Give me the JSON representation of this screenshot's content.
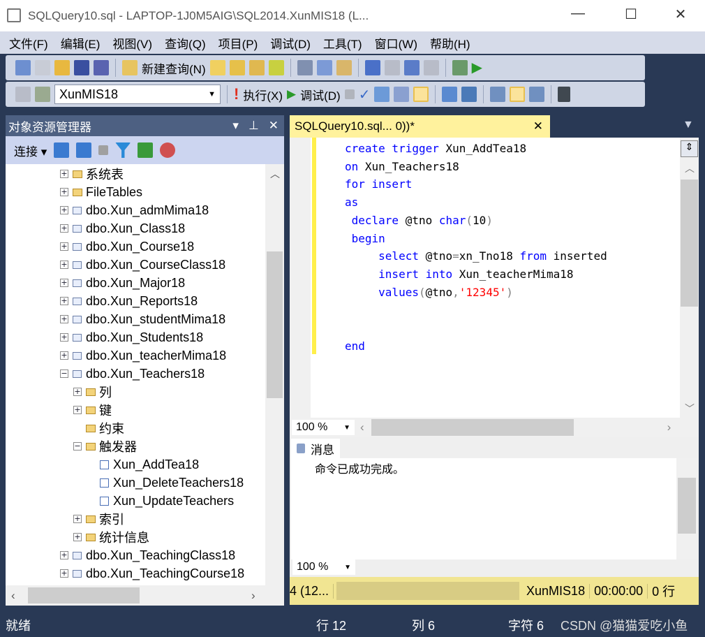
{
  "window": {
    "title": "SQLQuery10.sql - LAPTOP-1J0M5AIG\\SQL2014.XunMIS18 (L...",
    "min": "—",
    "max": "☐",
    "close": "✕"
  },
  "menu": [
    "文件(F)",
    "编辑(E)",
    "视图(V)",
    "查询(Q)",
    "项目(P)",
    "调试(D)",
    "工具(T)",
    "窗口(W)",
    "帮助(H)"
  ],
  "toolbar1": {
    "new_query": "新建查询(N)"
  },
  "toolbar2": {
    "database": "XunMIS18",
    "execute": "执行(X)",
    "debug": "调试(D)"
  },
  "object_explorer": {
    "title": "对象资源管理器",
    "connect": "连接",
    "tree": [
      {
        "label": "系统表",
        "type": "folder",
        "level": 0,
        "expander": "+"
      },
      {
        "label": "FileTables",
        "type": "folder",
        "level": 0,
        "expander": "+"
      },
      {
        "label": "dbo.Xun_admMima18",
        "type": "table",
        "level": 0,
        "expander": "+"
      },
      {
        "label": "dbo.Xun_Class18",
        "type": "table",
        "level": 0,
        "expander": "+"
      },
      {
        "label": "dbo.Xun_Course18",
        "type": "table",
        "level": 0,
        "expander": "+"
      },
      {
        "label": "dbo.Xun_CourseClass18",
        "type": "table",
        "level": 0,
        "expander": "+"
      },
      {
        "label": "dbo.Xun_Major18",
        "type": "table",
        "level": 0,
        "expander": "+"
      },
      {
        "label": "dbo.Xun_Reports18",
        "type": "table",
        "level": 0,
        "expander": "+"
      },
      {
        "label": "dbo.Xun_studentMima18",
        "type": "table",
        "level": 0,
        "expander": "+"
      },
      {
        "label": "dbo.Xun_Students18",
        "type": "table",
        "level": 0,
        "expander": "+"
      },
      {
        "label": "dbo.Xun_teacherMima18",
        "type": "table",
        "level": 0,
        "expander": "+"
      },
      {
        "label": "dbo.Xun_Teachers18",
        "type": "table",
        "level": 0,
        "expander": "−"
      },
      {
        "label": "列",
        "type": "folder",
        "level": 1,
        "expander": "+"
      },
      {
        "label": "键",
        "type": "folder",
        "level": 1,
        "expander": "+"
      },
      {
        "label": "约束",
        "type": "folder",
        "level": 1,
        "expander": ""
      },
      {
        "label": "触发器",
        "type": "folder",
        "level": 1,
        "expander": "−"
      },
      {
        "label": "Xun_AddTea18",
        "type": "trigger",
        "level": 2,
        "expander": ""
      },
      {
        "label": "Xun_DeleteTeachers18",
        "type": "trigger",
        "level": 2,
        "expander": ""
      },
      {
        "label": "Xun_UpdateTeachers",
        "type": "trigger",
        "level": 2,
        "expander": ""
      },
      {
        "label": "索引",
        "type": "folder",
        "level": 1,
        "expander": "+"
      },
      {
        "label": "统计信息",
        "type": "folder",
        "level": 1,
        "expander": "+"
      },
      {
        "label": "dbo.Xun_TeachingClass18",
        "type": "table",
        "level": 0,
        "expander": "+"
      },
      {
        "label": "dbo.Xun_TeachingCourse18",
        "type": "table",
        "level": 0,
        "expander": "+"
      }
    ]
  },
  "editor": {
    "tab": "SQLQuery10.sql...          0))*",
    "lines": [
      [
        {
          "t": "create trigger ",
          "c": "kw"
        },
        {
          "t": "Xun_AddTea18",
          "c": ""
        }
      ],
      [
        {
          "t": "on ",
          "c": "kw"
        },
        {
          "t": "Xun_Teachers18",
          "c": ""
        }
      ],
      [
        {
          "t": "for insert",
          "c": "kw"
        }
      ],
      [
        {
          "t": "as",
          "c": "kw"
        }
      ],
      [
        {
          "t": " declare ",
          "c": "kw"
        },
        {
          "t": "@tno ",
          "c": ""
        },
        {
          "t": "char",
          "c": "kw"
        },
        {
          "t": "(",
          "c": "gr"
        },
        {
          "t": "10",
          "c": ""
        },
        {
          "t": ")",
          "c": "gr"
        }
      ],
      [
        {
          "t": " begin",
          "c": "kw"
        }
      ],
      [
        {
          "t": "     select ",
          "c": "kw"
        },
        {
          "t": "@tno",
          "c": ""
        },
        {
          "t": "=",
          "c": "gr"
        },
        {
          "t": "xn_Tno18 ",
          "c": ""
        },
        {
          "t": "from ",
          "c": "kw"
        },
        {
          "t": "inserted",
          "c": ""
        }
      ],
      [
        {
          "t": "     insert into ",
          "c": "kw"
        },
        {
          "t": "Xun_teacherMima18",
          "c": ""
        }
      ],
      [
        {
          "t": "     values",
          "c": "kw"
        },
        {
          "t": "(",
          "c": "gr"
        },
        {
          "t": "@tno",
          "c": ""
        },
        {
          "t": ",",
          "c": "gr"
        },
        {
          "t": "'12345'",
          "c": "str"
        },
        {
          "t": ")",
          "c": "gr"
        }
      ],
      [],
      [],
      [
        {
          "t": "end",
          "c": "kw"
        }
      ]
    ],
    "zoom": "100 %"
  },
  "messages": {
    "tab": "消息",
    "text": "命令已成功完成。",
    "zoom": "100 %"
  },
  "query_status": {
    "server": "4 (12...",
    "database": "XunMIS18",
    "time": "00:00:00",
    "rows": "0 行"
  },
  "statusbar": {
    "ready": "就绪",
    "line": "行 12",
    "col": "列 6",
    "char": "字符 6",
    "watermark": "CSDN @猫猫爱吃小鱼"
  },
  "colors": {
    "frame": "#293955",
    "tab_active": "#fff29d",
    "status_yellow": "#f1e592",
    "keyword": "#0000ff",
    "string": "#ff0000"
  }
}
